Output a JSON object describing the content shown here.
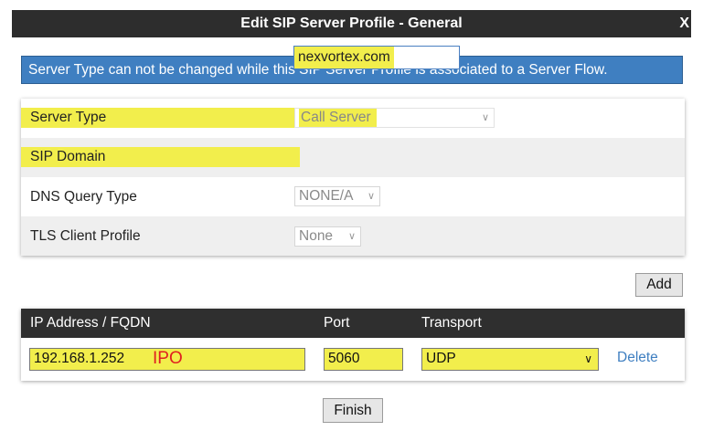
{
  "dialog": {
    "title": "Edit SIP Server Profile - General",
    "close_label": "X"
  },
  "notice": "Server Type can not be changed while this SIP Server Profile is associated to a Server Flow.",
  "form": {
    "server_type": {
      "label": "Server Type",
      "value": "Call Server"
    },
    "sip_domain": {
      "label": "SIP Domain",
      "value": "nexvortex.com"
    },
    "dns_query_type": {
      "label": "DNS Query Type",
      "value": "NONE/A"
    },
    "tls_client_profile": {
      "label": "TLS Client Profile",
      "value": "None"
    }
  },
  "add_label": "Add",
  "server_table": {
    "headers": {
      "address": "IP Address / FQDN",
      "port": "Port",
      "transport": "Transport"
    },
    "rows": [
      {
        "address": "192.168.1.252",
        "annotation": "IPO",
        "port": "5060",
        "transport": "UDP",
        "delete_label": "Delete"
      }
    ]
  },
  "finish_label": "Finish",
  "colors": {
    "titlebar": "#2d2d2d",
    "notice_bg": "#3f7fc1",
    "highlight": "#f2ee4c",
    "link": "#3f7fc1",
    "annotation": "#e02020"
  }
}
